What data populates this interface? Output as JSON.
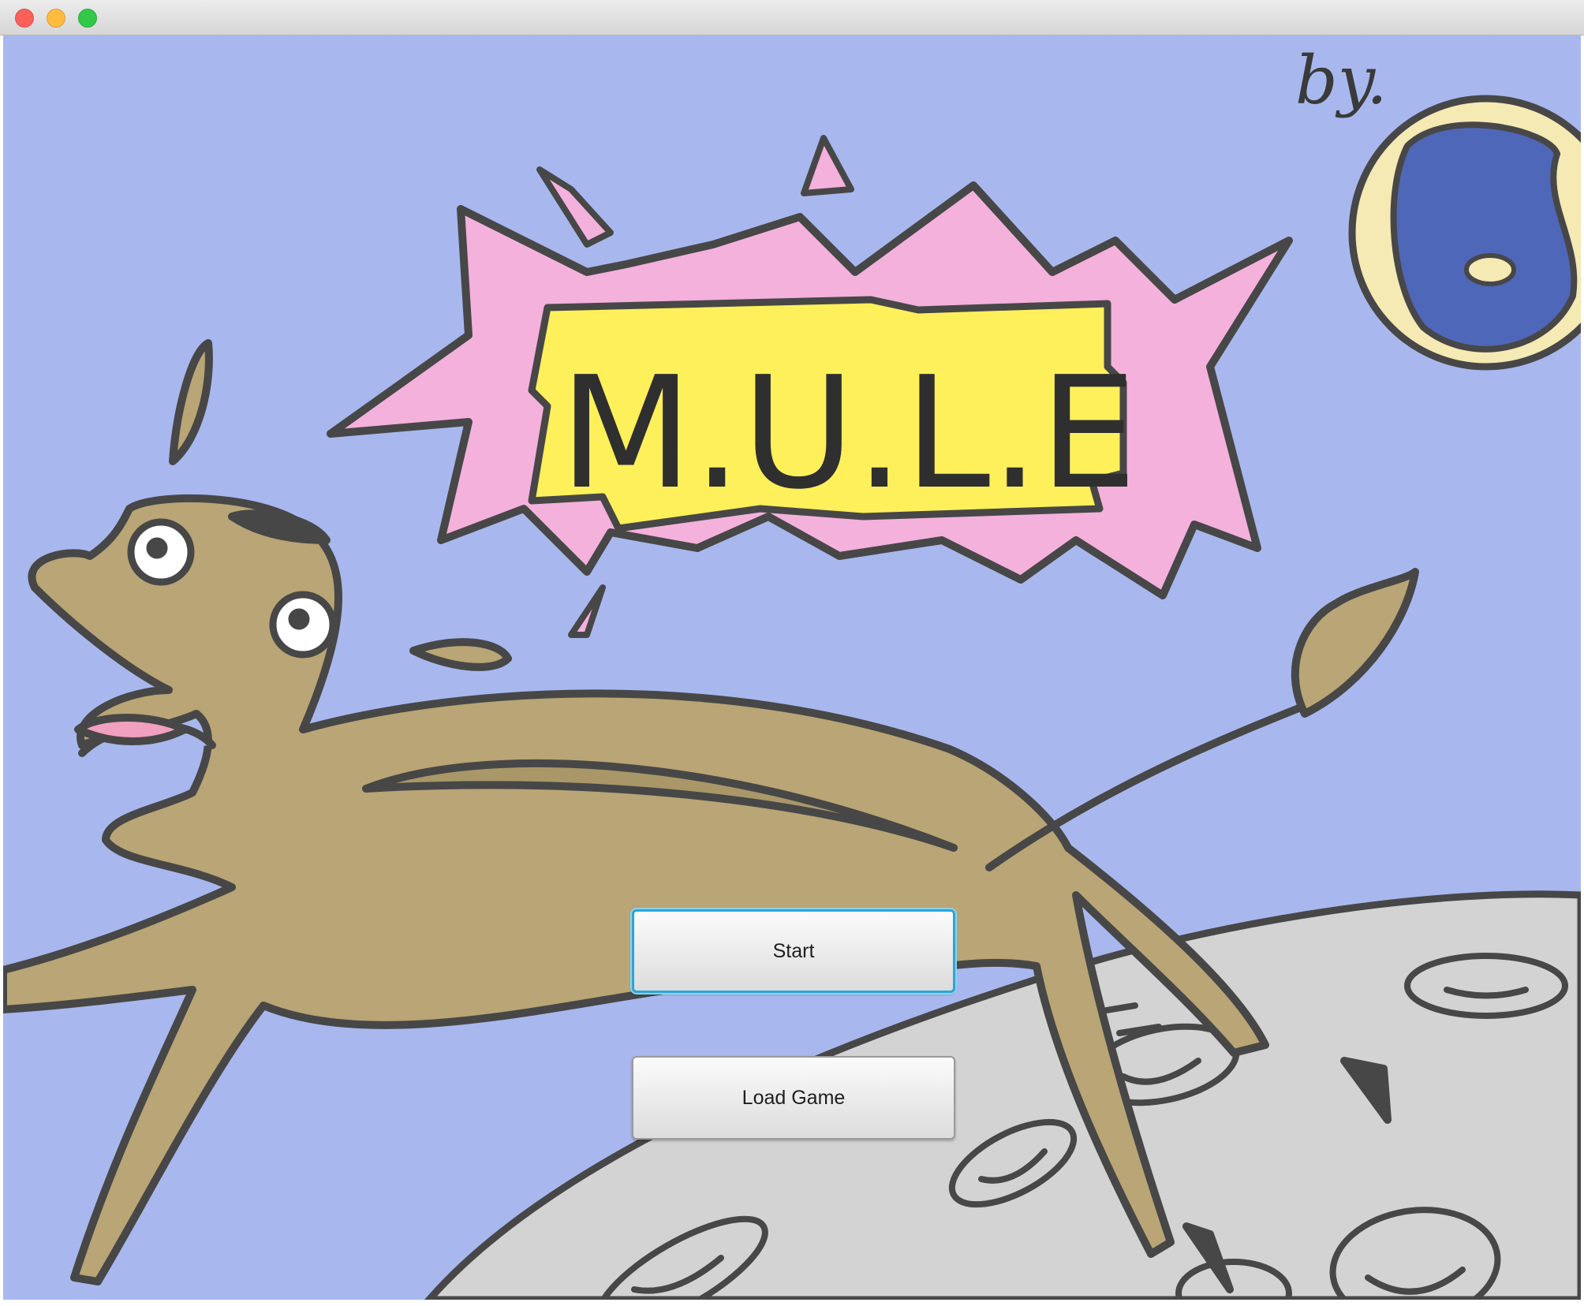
{
  "window": {
    "controls": [
      "close",
      "minimize",
      "maximize"
    ]
  },
  "title_screen": {
    "title": "M.U.L.E",
    "signature": "by.",
    "colors": {
      "sky": "#a8b8ee",
      "burst": "#f4b1dc",
      "title_plate": "#fdf05a",
      "mule_body": "#b9a575",
      "moon": "#d3d3d3",
      "planet": "#4f67b8",
      "outline": "#474747"
    }
  },
  "buttons": {
    "start_label": "Start",
    "load_label": "Load Game"
  }
}
